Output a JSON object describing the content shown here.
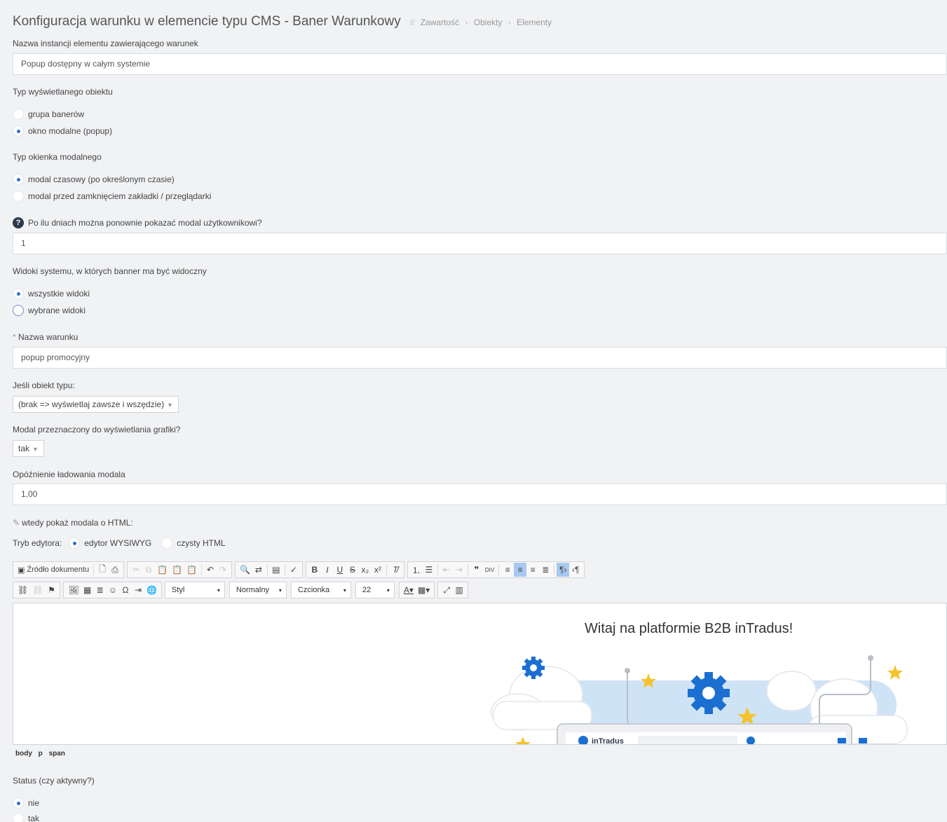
{
  "header": {
    "title": "Konfiguracja warunku w elemencie typu CMS - Baner Warunkowy",
    "separator": "//",
    "breadcrumbs": [
      "Zawartość",
      "Obiekty",
      "Elementy"
    ]
  },
  "form": {
    "instance_name": {
      "label": "Nazwa instancji elementu zawierającego warunek",
      "value": "Popup dostępny w całym systemie"
    },
    "object_type": {
      "label": "Typ wyświetlanego obiektu",
      "options": [
        "grupa banerów",
        "okno modalne (popup)"
      ],
      "selected": 1
    },
    "modal_type": {
      "label": "Typ okienka modalnego",
      "options": [
        "modal czasowy (po określonym czasie)",
        "modal przed zamknięciem zakładki / przeglądarki"
      ],
      "selected": 0
    },
    "repeat_days": {
      "label": "Po ilu dniach można ponownie pokazać modal użytkownikowi?",
      "value": "1",
      "help_icon": "question-circle-icon"
    },
    "views": {
      "label": "Widoki systemu, w których banner ma być widoczny",
      "options": [
        "wszystkie widoki",
        "wybrane widoki"
      ],
      "selected": 0
    },
    "condition_name": {
      "label": "Nazwa warunku",
      "required_mark": "*",
      "value": "popup promocyjny"
    },
    "if_object_type": {
      "label": "Jeśli obiekt typu:",
      "value": "(brak => wyświetlaj zawsze i wszędzie)"
    },
    "graphics_modal": {
      "label": "Modal przeznaczony do wyświetlania grafiki?",
      "value": "tak"
    },
    "load_delay": {
      "label": "Opóźnienie ładowania modala",
      "value": "1,00"
    },
    "html_modal": {
      "label": "wtedy pokaż modala o HTML:",
      "icon": "edit-icon"
    },
    "editor_mode": {
      "label": "Tryb edytora:",
      "options": [
        "edytor WYSIWYG",
        "czysty HTML"
      ],
      "selected": 0
    },
    "status": {
      "label": "Status (czy aktywny?)",
      "options": [
        "nie",
        "tak"
      ],
      "selected": 0
    }
  },
  "editor": {
    "source_label": "Źródło dokumentu",
    "combos": {
      "style": "Styl",
      "format": "Normalny",
      "font": "Czcionka",
      "size": "22"
    },
    "content": {
      "heading": "Witaj na platformie B2B inTradus!",
      "mockup_brand": "inTradus"
    },
    "path": [
      "body",
      "p",
      "span"
    ]
  },
  "colors": {
    "accent": "#2a6fd6",
    "background": "#f1f2f4",
    "star": "#f5c22b",
    "gear": "#1a6fd1",
    "cloud_band": "#cfe3f7"
  }
}
